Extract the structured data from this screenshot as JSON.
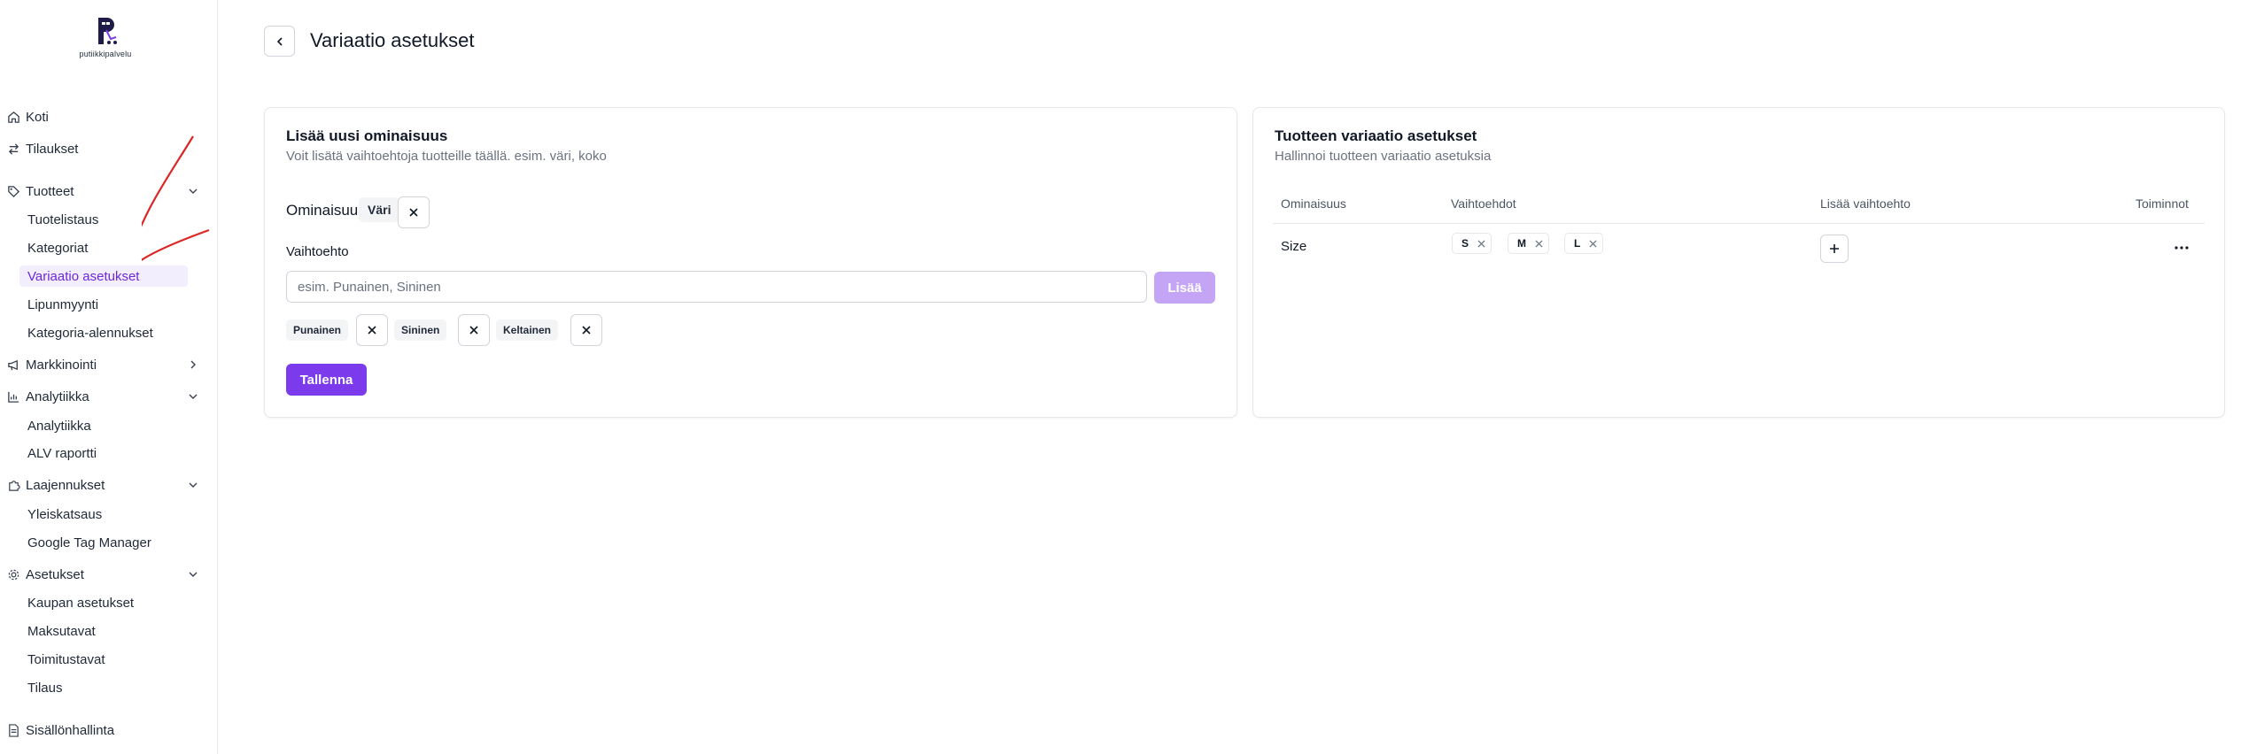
{
  "brand": {
    "logo_text": "putiikkipalvelu",
    "accent": "#7c3aed",
    "accent_light": "#c4a5f5",
    "active_bg": "#f3eefe"
  },
  "sidebar": {
    "home": {
      "label": "Koti",
      "icon": "home-icon"
    },
    "orders": {
      "label": "Tilaukset",
      "icon": "arrows-exchange-icon"
    },
    "products": {
      "label": "Tuotteet",
      "icon": "tag-icon",
      "items": [
        "Tuotelistaus",
        "Kategoriat",
        "Variaatio asetukset",
        "Lipunmyynti",
        "Kategoria-alennukset"
      ]
    },
    "marketing": {
      "label": "Markkinointi",
      "icon": "megaphone-icon"
    },
    "analytics": {
      "label": "Analytiikka",
      "icon": "chart-icon",
      "items": [
        "Analytiikka",
        "ALV raportti"
      ]
    },
    "extensions": {
      "label": "Laajennukset",
      "icon": "puzzle-icon",
      "items": [
        "Yleiskatsaus",
        "Google Tag Manager"
      ]
    },
    "settings": {
      "label": "Asetukset",
      "icon": "gear-icon",
      "items": [
        "Kaupan asetukset",
        "Maksutavat",
        "Toimitustavat",
        "Tilaus"
      ]
    },
    "content": {
      "label": "Sisällönhallinta",
      "icon": "document-icon"
    }
  },
  "page": {
    "title": "Variaatio asetukset"
  },
  "new_property": {
    "title": "Lisää uusi ominaisuus",
    "subtitle": "Voit lisätä vaihtoehtoja tuotteille täällä. esim. väri, koko",
    "property_label": "Ominaisuus :",
    "property_value": "Väri",
    "options_label": "Vaihtoehto",
    "options_placeholder": "esim. Punainen, Sininen",
    "add_label": "Lisää",
    "options": [
      "Punainen",
      "Sininen",
      "Keltainen"
    ],
    "save_label": "Tallenna"
  },
  "variation_settings": {
    "title": "Tuotteen variaatio asetukset",
    "subtitle": "Hallinnoi tuotteen variaatio asetuksia",
    "columns": [
      "Ominaisuus",
      "Vaihtoehdot",
      "Lisää vaihtoehto",
      "Toiminnot"
    ],
    "rows": [
      {
        "property": "Size",
        "values": [
          "S",
          "M",
          "L"
        ]
      }
    ]
  }
}
